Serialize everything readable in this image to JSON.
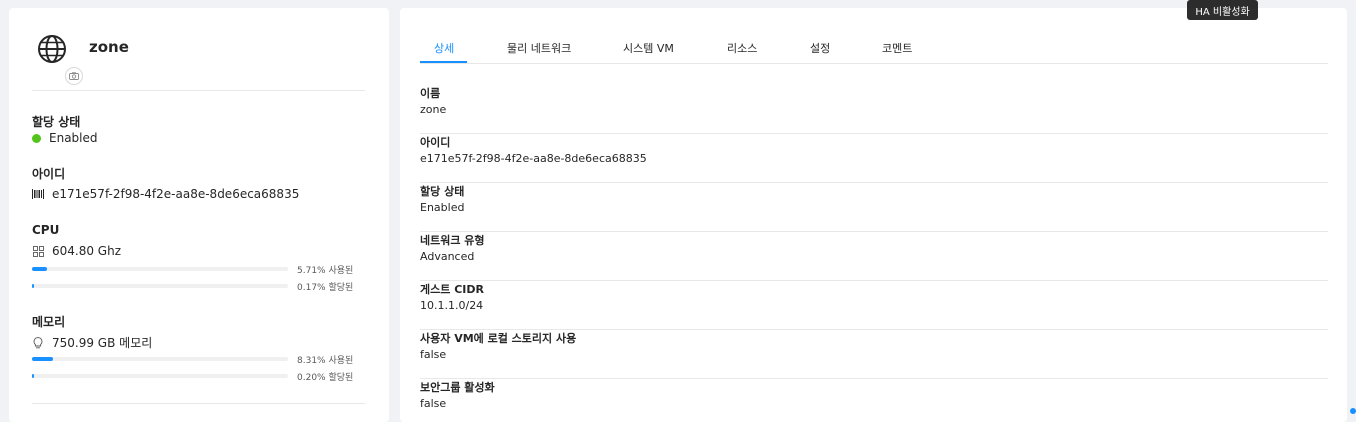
{
  "resource": {
    "name": "zone",
    "icon": "globe-icon"
  },
  "sidebar": {
    "allocation": {
      "label": "할당 상태",
      "value": "Enabled",
      "color": "#52c41a"
    },
    "id": {
      "label": "아이디",
      "value": "e171e57f-2f98-4f2e-aa8e-8de6eca68835",
      "icon": "barcode-icon"
    },
    "cpu": {
      "label": "CPU",
      "value": "604.80 Ghz",
      "icon": "cpu-icon",
      "used": {
        "percent": 5.71,
        "text": "5.71% 사용된"
      },
      "allocated": {
        "percent": 0.17,
        "text": "0.17% 할당된"
      }
    },
    "memory": {
      "label": "메모리",
      "value": "750.99 GB 메모리",
      "icon": "bulb-icon",
      "used": {
        "percent": 8.31,
        "text": "8.31% 사용된"
      },
      "allocated": {
        "percent": 0.2,
        "text": "0.20% 할당된"
      }
    }
  },
  "tabs": [
    {
      "label": "상세",
      "active": true
    },
    {
      "label": "물리 네트워크",
      "active": false
    },
    {
      "label": "시스템 VM",
      "active": false
    },
    {
      "label": "리소스",
      "active": false
    },
    {
      "label": "설정",
      "active": false
    },
    {
      "label": "코멘트",
      "active": false
    }
  ],
  "details": [
    {
      "label": "이름",
      "value": "zone"
    },
    {
      "label": "아이디",
      "value": "e171e57f-2f98-4f2e-aa8e-8de6eca68835"
    },
    {
      "label": "할당 상태",
      "value": "Enabled"
    },
    {
      "label": "네트워크 유형",
      "value": "Advanced"
    },
    {
      "label": "게스트 CIDR",
      "value": "10.1.1.0/24"
    },
    {
      "label": "사용자 VM에 로컬 스토리지 사용",
      "value": "false"
    },
    {
      "label": "보안그룹 활성화",
      "value": "false"
    }
  ],
  "tooltip": {
    "text": "HA 비활성화"
  },
  "colors": {
    "accent": "#1890ff",
    "success": "#52c41a",
    "track": "#f0f0f0",
    "divider": "#e8e8e8"
  }
}
